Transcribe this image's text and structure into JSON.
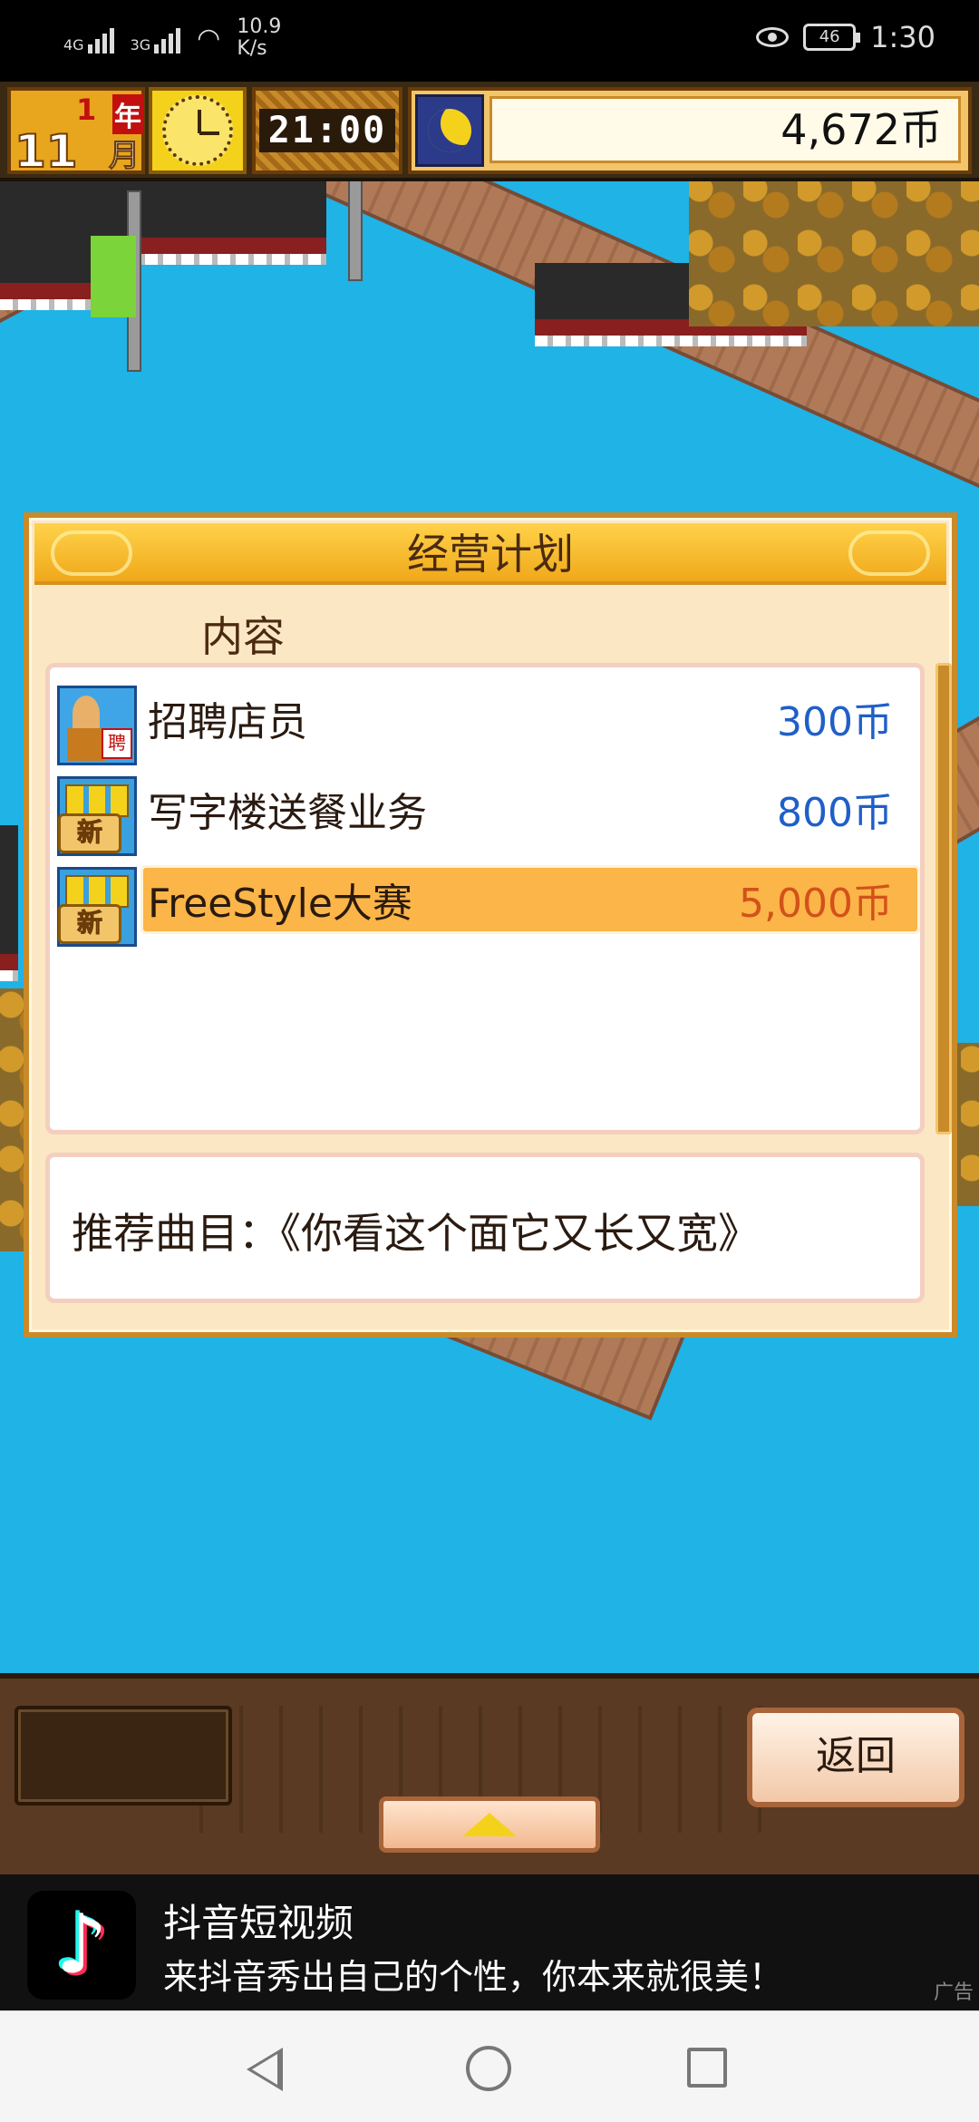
{
  "status_bar": {
    "network_1": "4G",
    "network_2": "3G",
    "speed_value": "10.9",
    "speed_unit": "K/s",
    "battery": "46",
    "time": "1:30"
  },
  "hud": {
    "year_number": "1",
    "year_label": "年",
    "month_number": "11",
    "month_label": "月",
    "game_time": "21:00",
    "money": "4,672币"
  },
  "dialog": {
    "title": "经营计划",
    "column_header": "内容",
    "items": [
      {
        "label": "招聘店员",
        "price": "300币",
        "badge": "",
        "icon_tag": "聘",
        "selected": false
      },
      {
        "label": "写字楼送餐业务",
        "price": "800币",
        "badge": "新",
        "selected": false
      },
      {
        "label": "FreeStyle大赛",
        "price": "5,000币",
        "badge": "新",
        "selected": true
      }
    ],
    "recommendation": "推荐曲目：《你看这个面它又长又宽》"
  },
  "bottom_bar": {
    "back_button": "返回"
  },
  "ad": {
    "app_name": "抖音短视频",
    "description": "来抖音秀出自己的个性，你本来就很美！",
    "ad_label": "广告"
  },
  "icons": {
    "eye": "eye-icon",
    "battery": "battery-icon",
    "clock": "clock-icon",
    "moon": "moon-icon",
    "tiktok": "tiktok-logo-icon",
    "up_arrow": "triangle-up-icon"
  }
}
